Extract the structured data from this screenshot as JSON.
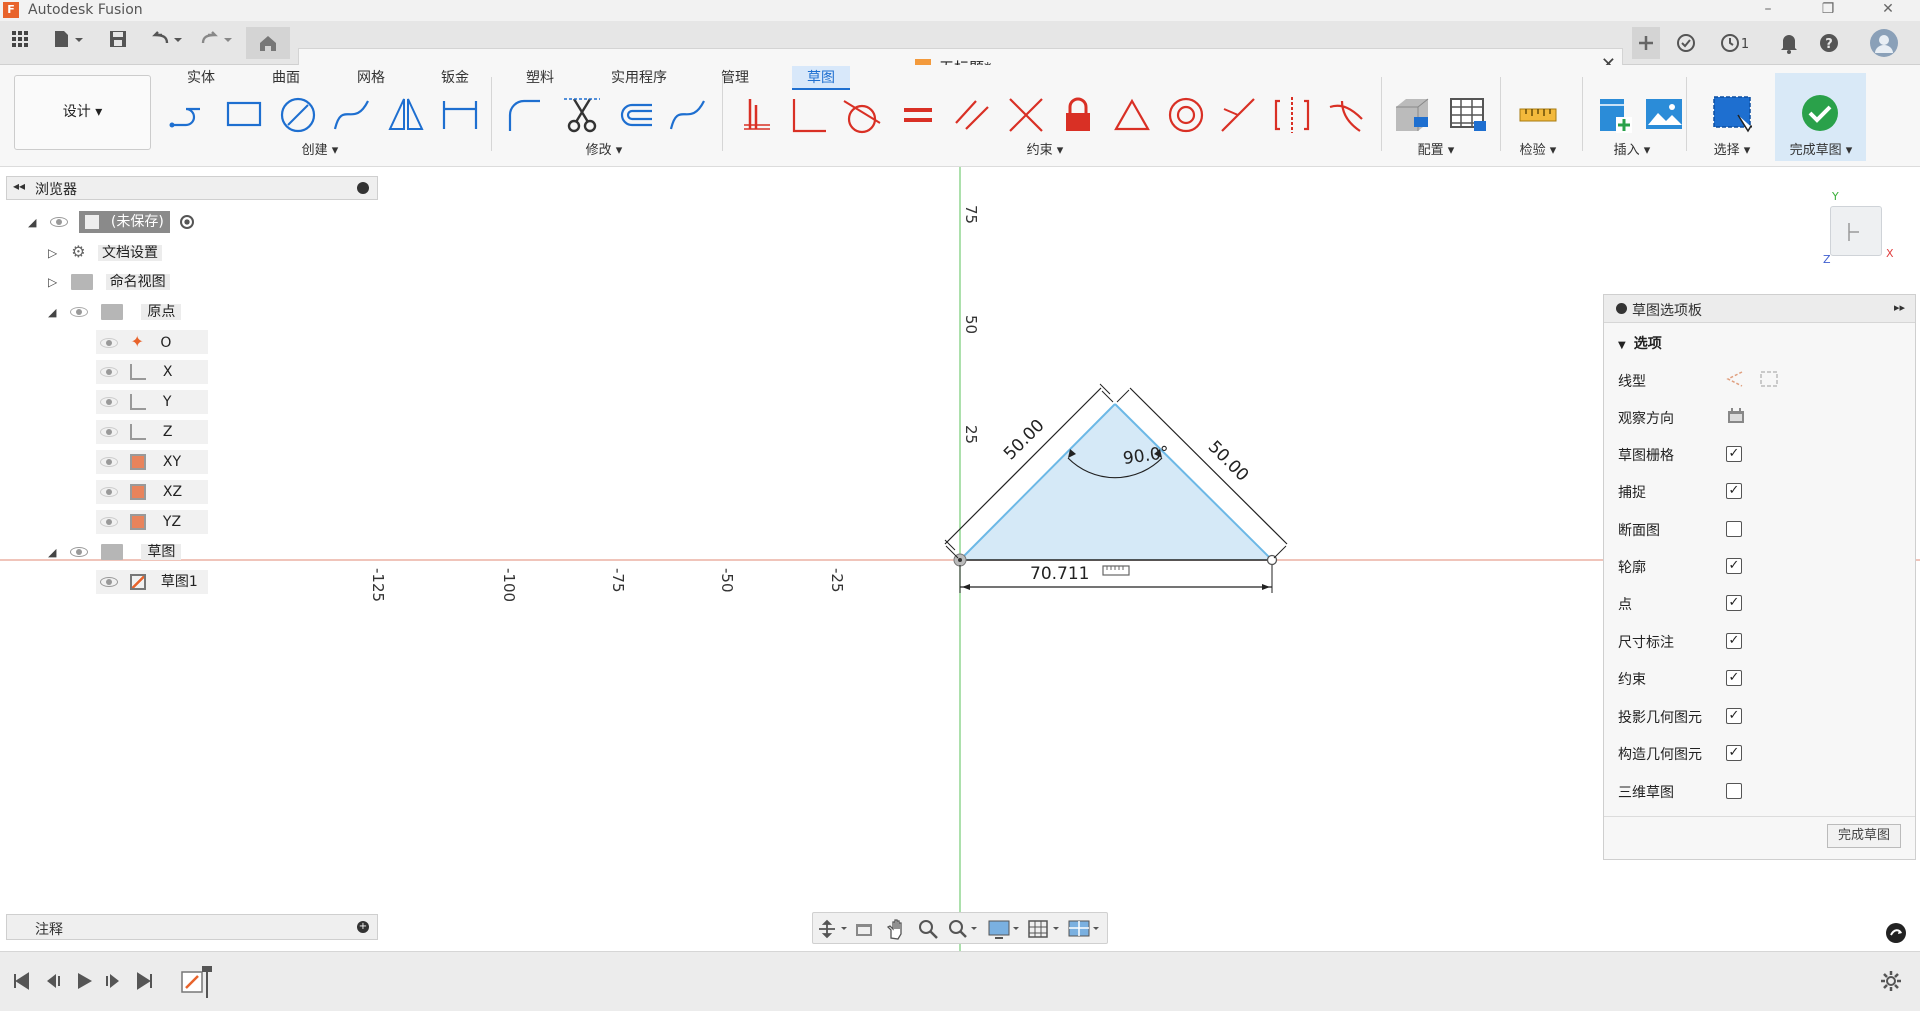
{
  "app": {
    "title": "Autodesk Fusion",
    "logo_letter": "F"
  },
  "window_controls": {
    "minimize": "–",
    "restore": "❐",
    "close": "✕"
  },
  "qat": {
    "icons": [
      "apps-grid-icon",
      "file-icon",
      "save-icon",
      "undo-icon",
      "redo-icon",
      "home-icon"
    ]
  },
  "document": {
    "title": "无标题*",
    "close": "✕"
  },
  "header_right": {
    "job_count": "1"
  },
  "ribbon": {
    "workspace": "设计 ▾",
    "tabs": [
      "实体",
      "曲面",
      "网格",
      "钣金",
      "塑料",
      "实用程序",
      "管理",
      "草图"
    ],
    "active_tab": "草图",
    "groups": {
      "create": "创建 ▾",
      "modify": "修改 ▾",
      "constraints": "约束 ▾",
      "configure": "配置 ▾",
      "inspect": "检验 ▾",
      "insert": "插入 ▾",
      "select": "选择 ▾",
      "finish": "完成草图 ▾"
    }
  },
  "browser": {
    "title": "浏览器",
    "root": "(未保存)",
    "items": [
      "文档设置",
      "命名视图",
      "原点",
      "O",
      "X",
      "Y",
      "Z",
      "XY",
      "XZ",
      "YZ",
      "草图",
      "草图1"
    ]
  },
  "notes": {
    "title": "注释"
  },
  "sketch": {
    "dim_left": "50.00",
    "dim_right": "50.00",
    "dim_angle": "90.0°",
    "dim_bottom": "70.711",
    "axis_x_ticks": [
      "-125",
      "-100",
      "-75",
      "-50",
      "-25"
    ],
    "axis_y_ticks": [
      "75",
      "50",
      "25"
    ]
  },
  "viewcube": {
    "y": "Y",
    "x": "X",
    "z": "Z"
  },
  "palette": {
    "title": "草图选项板",
    "section": "选项",
    "rows": [
      {
        "label": "线型",
        "type": "icons"
      },
      {
        "label": "观察方向",
        "type": "icon"
      },
      {
        "label": "草图栅格",
        "checked": true
      },
      {
        "label": "捕捉",
        "checked": true
      },
      {
        "label": "断面图",
        "checked": false
      },
      {
        "label": "轮廓",
        "checked": true
      },
      {
        "label": "点",
        "checked": true
      },
      {
        "label": "尺寸标注",
        "checked": true
      },
      {
        "label": "约束",
        "checked": true
      },
      {
        "label": "投影几何图元",
        "checked": true
      },
      {
        "label": "构造几何图元",
        "checked": true
      },
      {
        "label": "三维草图",
        "checked": false
      }
    ],
    "finish_button": "完成草图"
  },
  "colors": {
    "accent": "#1e6fd0",
    "sketch_fill": "#d5e9f7",
    "sketch_line": "#6cb8e6",
    "x_axis": "#e8a090",
    "y_axis": "#7fcf7f"
  }
}
